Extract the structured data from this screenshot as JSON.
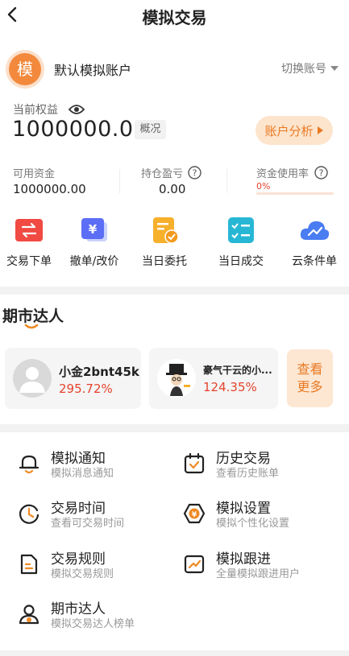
{
  "nav": {
    "title": "模拟交易"
  },
  "account": {
    "avatar_char": "模",
    "name": "默认模拟账户",
    "switch_label": "切换账号"
  },
  "equity": {
    "label": "当前权益",
    "value": "1000000.00",
    "overview_label": "概况",
    "analysis_button": "账户分析"
  },
  "stats": [
    {
      "label": "可用资金",
      "value": "1000000.00"
    },
    {
      "label": "持仓盈亏",
      "value": "0.00"
    },
    {
      "label": "资金使用率",
      "value": "0%"
    }
  ],
  "tools": [
    {
      "label": "交易下单",
      "icon": "trade-order-icon",
      "color": "#f04a42"
    },
    {
      "label": "撤单/改价",
      "icon": "cancel-order-icon",
      "color": "#5b6ef5"
    },
    {
      "label": "当日委托",
      "icon": "today-entrust-icon",
      "color": "#f7b02b"
    },
    {
      "label": "当日成交",
      "icon": "today-deal-icon",
      "color": "#27b7d4"
    },
    {
      "label": "云条件单",
      "icon": "cloud-condition-icon",
      "color": "#4a7cf2"
    }
  ],
  "experts": {
    "title": "期市达人",
    "items": [
      {
        "name": "小金2bnt45k",
        "return": "295.72%"
      },
      {
        "name": "豪气干云的小...",
        "return": "124.35%"
      }
    ],
    "more_label": "查看\n更多"
  },
  "menu": [
    {
      "title": "模拟通知",
      "sub": "模拟消息通知",
      "icon": "bell-icon"
    },
    {
      "title": "历史交易",
      "sub": "查看历史账单",
      "icon": "calendar-icon"
    },
    {
      "title": "交易时间",
      "sub": "查看可交易时间",
      "icon": "clock-icon"
    },
    {
      "title": "模拟设置",
      "sub": "模拟个性化设置",
      "icon": "settings-icon"
    },
    {
      "title": "交易规则",
      "sub": "模拟交易规则",
      "icon": "document-icon"
    },
    {
      "title": "模拟跟进",
      "sub": "全量模拟跟进用户",
      "icon": "trend-icon"
    },
    {
      "title": "期市达人",
      "sub": "模拟交易达人榜单",
      "icon": "user-icon"
    }
  ],
  "colors": {
    "accent": "#f08a24",
    "red": "#e5432d",
    "peach": "#fde7d3"
  }
}
